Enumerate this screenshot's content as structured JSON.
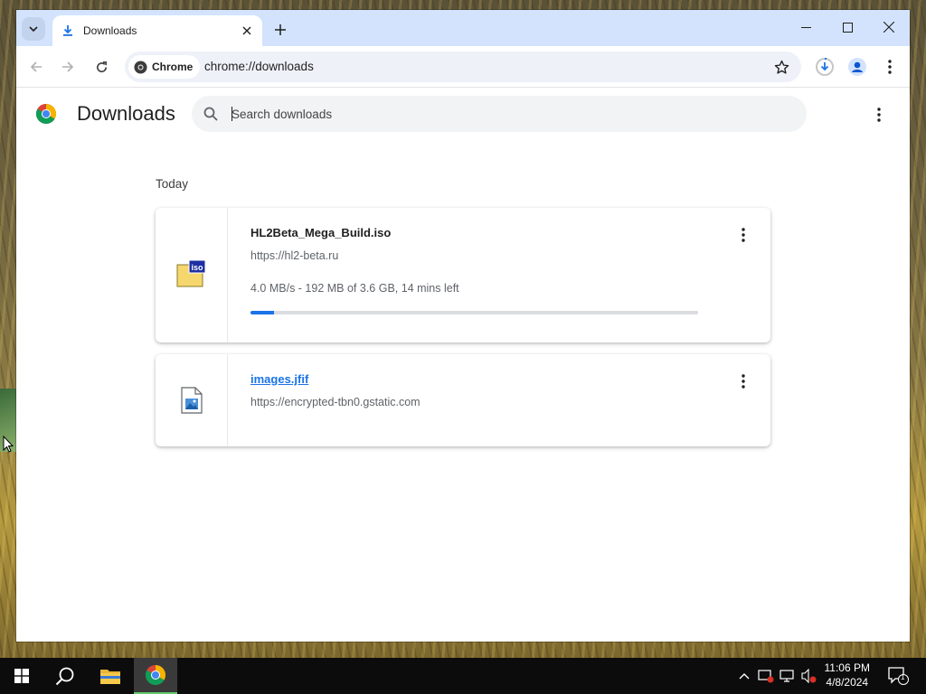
{
  "browser": {
    "tab": {
      "title": "Downloads"
    },
    "omnibox": {
      "chip_label": "Chrome",
      "url": "chrome://downloads"
    }
  },
  "page": {
    "title": "Downloads",
    "search": {
      "placeholder": "Search downloads"
    },
    "section_label": "Today",
    "downloads": [
      {
        "file_name": "HL2Beta_Mega_Build.iso",
        "source_url": "https://hl2-beta.ru",
        "status": "4.0 MB/s - 192 MB of 3.6 GB, 14 mins left",
        "progress_percent": 5.2,
        "icon": "iso-file-icon"
      },
      {
        "file_name": "images.jfif",
        "source_url": "https://encrypted-tbn0.gstatic.com",
        "icon": "image-file-icon"
      }
    ]
  },
  "taskbar": {
    "time": "11:06 PM",
    "date": "4/8/2024",
    "notification_count": "1"
  },
  "colors": {
    "titlebar": "#d3e3fd",
    "accent": "#1a73e8",
    "taskbar": "#0c0c0c"
  }
}
